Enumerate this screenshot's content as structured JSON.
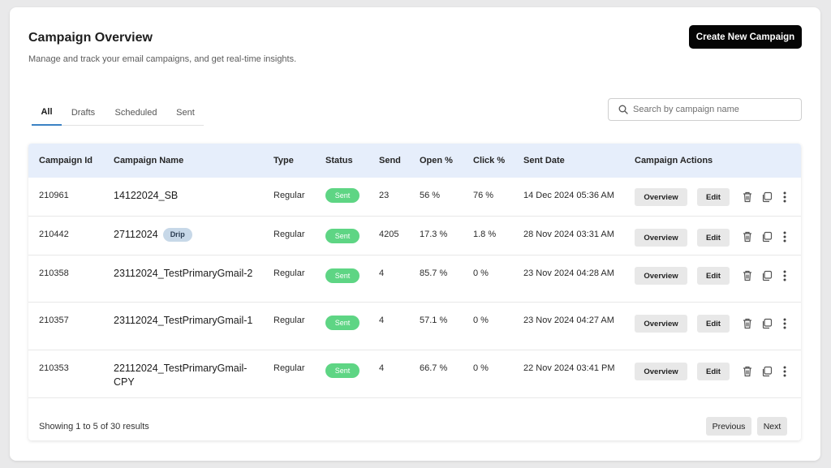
{
  "header": {
    "title": "Campaign Overview",
    "subtitle": "Manage and track your email campaigns, and get real-time insights.",
    "create_label": "Create New Campaign"
  },
  "tabs": [
    {
      "label": "All",
      "active": true
    },
    {
      "label": "Drafts",
      "active": false
    },
    {
      "label": "Scheduled",
      "active": false
    },
    {
      "label": "Sent",
      "active": false
    }
  ],
  "search": {
    "placeholder": "Search by campaign name",
    "value": "",
    "icon": "search-icon"
  },
  "table": {
    "columns": [
      "Campaign Id",
      "Campaign Name",
      "Type",
      "Status",
      "Send",
      "Open %",
      "Click %",
      "Sent Date",
      "Campaign Actions"
    ],
    "rows": [
      {
        "id": "210961",
        "name": "14122024_SB",
        "tag": "",
        "type": "Regular",
        "status": "Sent",
        "send": "23",
        "open": "56 %",
        "click": "76 %",
        "date": "14 Dec 2024 05:36 AM"
      },
      {
        "id": "210442",
        "name": "27112024",
        "tag": "Drip",
        "type": "Regular",
        "status": "Sent",
        "send": "4205",
        "open": "17.3 %",
        "click": "1.8 %",
        "date": "28 Nov 2024 03:31 AM"
      },
      {
        "id": "210358",
        "name": "23112024_TestPrimaryGmail-2",
        "tag": "",
        "type": "Regular",
        "status": "Sent",
        "send": "4",
        "open": "85.7 %",
        "click": "0 %",
        "date": "23 Nov 2024 04:28 AM"
      },
      {
        "id": "210357",
        "name": "23112024_TestPrimaryGmail-1",
        "tag": "",
        "type": "Regular",
        "status": "Sent",
        "send": "4",
        "open": "57.1 %",
        "click": "0 %",
        "date": "23 Nov 2024 04:27 AM"
      },
      {
        "id": "210353",
        "name": "22112024_TestPrimaryGmail-CPY",
        "tag": "",
        "type": "Regular",
        "status": "Sent",
        "send": "4",
        "open": "66.7 %",
        "click": "0 %",
        "date": "22 Nov 2024 03:41 PM"
      }
    ],
    "actions": {
      "overview_label": "Overview",
      "edit_label": "Edit",
      "icons": [
        "trash-icon",
        "copy-icon",
        "more-vertical-icon"
      ]
    }
  },
  "pagination": {
    "summary": "Showing 1 to 5 of 30 results",
    "previous_label": "Previous",
    "next_label": "Next"
  },
  "colors": {
    "primary_button": "#050505",
    "header_bg": "#e6eefb",
    "sent_badge": "#5ed584",
    "drip_badge": "#c7d8e8",
    "active_tab": "#3b82c4"
  }
}
